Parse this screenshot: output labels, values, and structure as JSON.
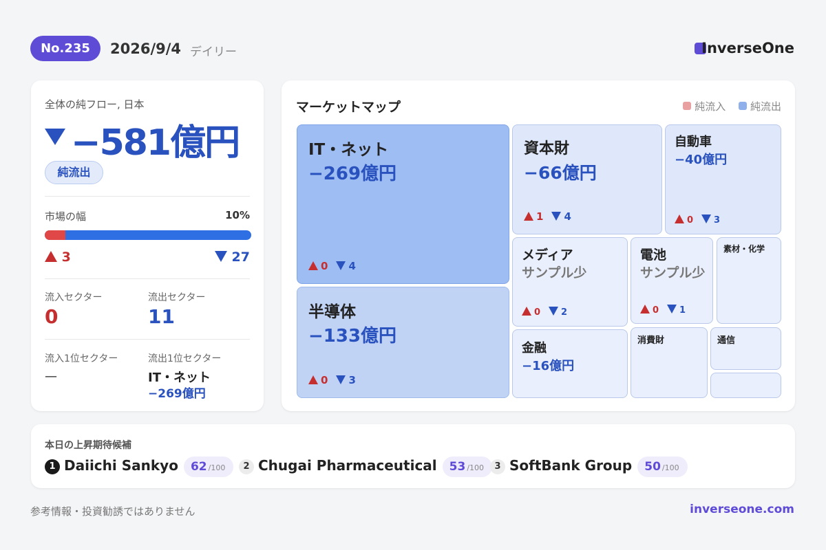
{
  "header": {
    "issue": "No.235",
    "date": "2026/9/4",
    "frequency": "デイリー",
    "brand": "InverseOne",
    "brand_color": "#5e4bd6"
  },
  "summary": {
    "label": "全体の純フロー, 日本",
    "total": "−581億円",
    "badge": "純流出",
    "breadth_label": "市場の幅",
    "breadth_pct": "10%",
    "breadth_fraction": 0.1,
    "advancers": "3",
    "decliners": "27",
    "inflow_sectors_label": "流入セクター",
    "inflow_sectors": "0",
    "outflow_sectors_label": "流出セクター",
    "outflow_sectors": "11",
    "top_inflow_label": "流入1位セクター",
    "top_inflow": "—",
    "top_outflow_label": "流出1位セクター",
    "top_outflow_name": "IT・ネット",
    "top_outflow_value": "−269億円"
  },
  "market_map": {
    "title": "マーケットマップ",
    "legend_in": "純流入",
    "legend_out": "純流出",
    "legend_in_color": "#e8a0a0",
    "legend_out_color": "#8fb0ea",
    "tiles": [
      {
        "name": "IT・ネット",
        "value": "−269億円",
        "up": "0",
        "down": "4"
      },
      {
        "name": "半導体",
        "value": "−133億円",
        "up": "0",
        "down": "3"
      },
      {
        "name": "資本財",
        "value": "−66億円",
        "up": "1",
        "down": "4"
      },
      {
        "name": "自動車",
        "value": "−40億円",
        "up": "0",
        "down": "3"
      },
      {
        "name": "メディア",
        "value": "サンプル少",
        "up": "0",
        "down": "2"
      },
      {
        "name": "電池",
        "value": "サンプル少",
        "up": "0",
        "down": "1"
      },
      {
        "name": "素材・化学"
      },
      {
        "name": "金融",
        "value": "−16億円"
      },
      {
        "name": "消費財"
      },
      {
        "name": "通信"
      }
    ]
  },
  "picks": {
    "title": "本日の上昇期待候補",
    "items": [
      {
        "rank": "1",
        "name": "Daiichi Sankyo",
        "score": "62",
        "max": "/100"
      },
      {
        "rank": "2",
        "name": "Chugai Pharmaceutical",
        "score": "53",
        "max": "/100"
      },
      {
        "rank": "3",
        "name": "SoftBank Group",
        "score": "50",
        "max": "/100"
      }
    ]
  },
  "footer": {
    "note": "参考情報・投資勧誘ではありません",
    "url": "inverseone.com"
  }
}
